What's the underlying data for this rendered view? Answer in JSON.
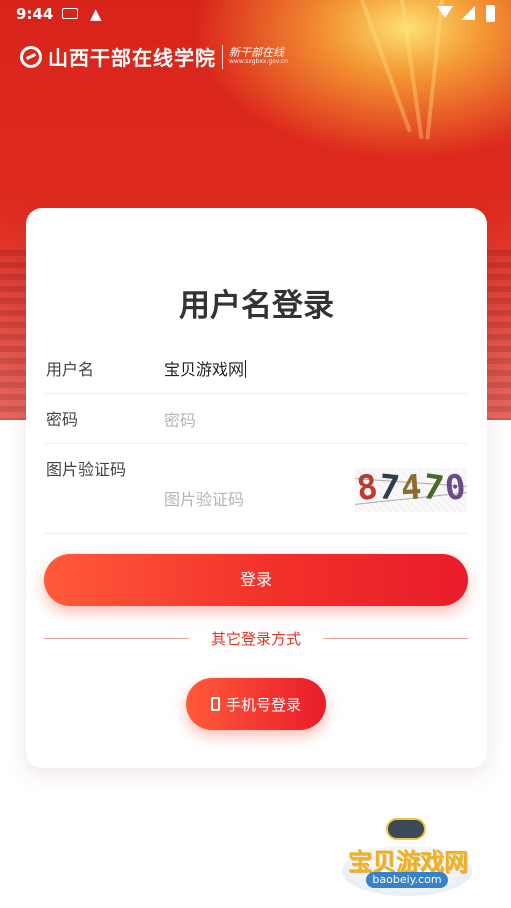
{
  "status_bar": {
    "time": "9:44",
    "icons": [
      "keyboard-icon",
      "warning-icon",
      "wifi-icon",
      "signal-icon",
      "battery-icon"
    ]
  },
  "header": {
    "logo_title": "山西干部在线学院",
    "logo_slogan": "新干部在线",
    "logo_url": "www.sxgbxx.gov.cn"
  },
  "login_form": {
    "title": "用户名登录",
    "username": {
      "label": "用户名",
      "value": "宝贝游戏网"
    },
    "password": {
      "label": "密码",
      "placeholder": "密码"
    },
    "captcha": {
      "label": "图片验证码",
      "placeholder": "图片验证码",
      "image_text": "87470"
    },
    "submit_label": "登录",
    "other_methods_label": "其它登录方式",
    "phone_login_label": "手机号登录"
  },
  "watermark": {
    "name": "宝贝游戏网",
    "url": "baobeiy.com"
  },
  "colors": {
    "brand_red": "#e02a1e",
    "button_start": "#ff5a3a",
    "button_end": "#e81c2a",
    "watermark_gold": "#f0b020",
    "watermark_blue": "#3a82c8"
  }
}
